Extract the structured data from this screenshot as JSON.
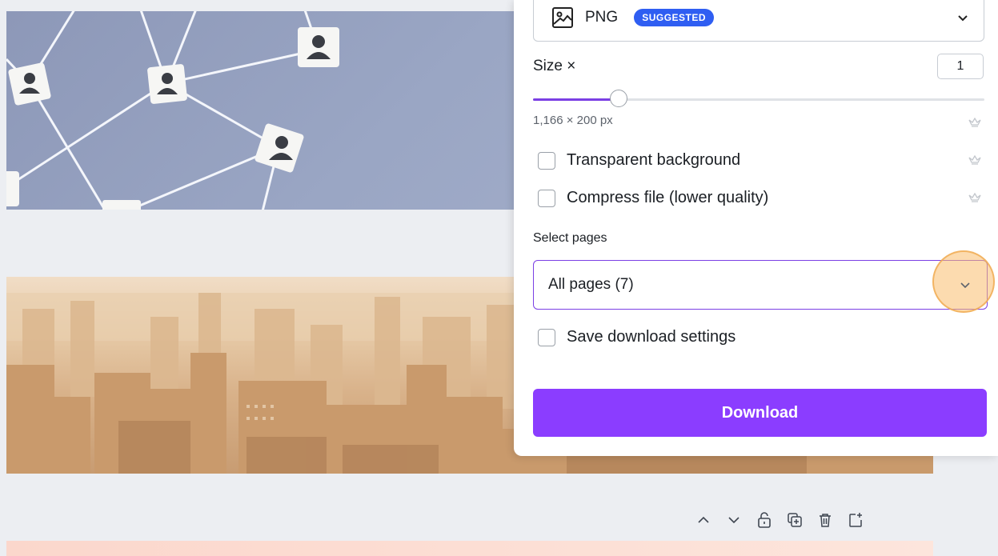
{
  "panel": {
    "file_type": {
      "value": "PNG",
      "badge": "SUGGESTED"
    },
    "size": {
      "label": "Size ×",
      "value": "1",
      "slider_fraction": 0.19
    },
    "dimensions": "1,166 × 200 px",
    "options": [
      {
        "label": "Transparent background",
        "checked": false,
        "pro": true
      },
      {
        "label": "Compress file (lower quality)",
        "checked": false,
        "pro": true
      }
    ],
    "select_pages": {
      "label": "Select pages",
      "value": "All pages (7)"
    },
    "save_settings": {
      "label": "Save download settings",
      "checked": false
    },
    "download_label": "Download"
  },
  "page_tools": [
    "move-up-icon",
    "move-down-icon",
    "lock-icon",
    "duplicate-icon",
    "trash-icon",
    "add-page-icon"
  ],
  "colors": {
    "accent": "#8b3dff",
    "badge": "#2f5ef2",
    "highlight": "#f5b86a"
  }
}
